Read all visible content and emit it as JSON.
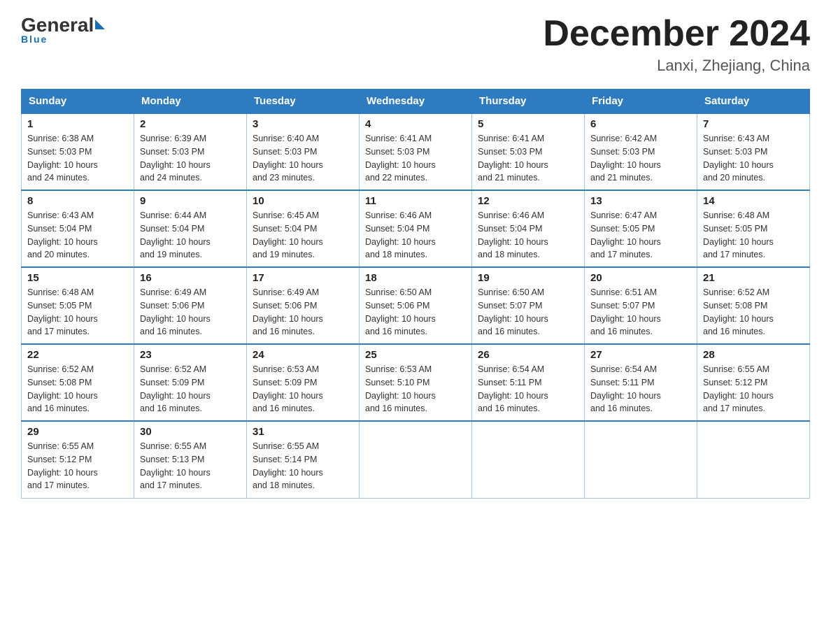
{
  "logo": {
    "general": "General",
    "blue": "Blue",
    "underline": "Blue"
  },
  "title": "December 2024",
  "location": "Lanxi, Zhejiang, China",
  "headers": [
    "Sunday",
    "Monday",
    "Tuesday",
    "Wednesday",
    "Thursday",
    "Friday",
    "Saturday"
  ],
  "weeks": [
    [
      {
        "day": "1",
        "sunrise": "6:38 AM",
        "sunset": "5:03 PM",
        "daylight": "10 hours and 24 minutes."
      },
      {
        "day": "2",
        "sunrise": "6:39 AM",
        "sunset": "5:03 PM",
        "daylight": "10 hours and 24 minutes."
      },
      {
        "day": "3",
        "sunrise": "6:40 AM",
        "sunset": "5:03 PM",
        "daylight": "10 hours and 23 minutes."
      },
      {
        "day": "4",
        "sunrise": "6:41 AM",
        "sunset": "5:03 PM",
        "daylight": "10 hours and 22 minutes."
      },
      {
        "day": "5",
        "sunrise": "6:41 AM",
        "sunset": "5:03 PM",
        "daylight": "10 hours and 21 minutes."
      },
      {
        "day": "6",
        "sunrise": "6:42 AM",
        "sunset": "5:03 PM",
        "daylight": "10 hours and 21 minutes."
      },
      {
        "day": "7",
        "sunrise": "6:43 AM",
        "sunset": "5:03 PM",
        "daylight": "10 hours and 20 minutes."
      }
    ],
    [
      {
        "day": "8",
        "sunrise": "6:43 AM",
        "sunset": "5:04 PM",
        "daylight": "10 hours and 20 minutes."
      },
      {
        "day": "9",
        "sunrise": "6:44 AM",
        "sunset": "5:04 PM",
        "daylight": "10 hours and 19 minutes."
      },
      {
        "day": "10",
        "sunrise": "6:45 AM",
        "sunset": "5:04 PM",
        "daylight": "10 hours and 19 minutes."
      },
      {
        "day": "11",
        "sunrise": "6:46 AM",
        "sunset": "5:04 PM",
        "daylight": "10 hours and 18 minutes."
      },
      {
        "day": "12",
        "sunrise": "6:46 AM",
        "sunset": "5:04 PM",
        "daylight": "10 hours and 18 minutes."
      },
      {
        "day": "13",
        "sunrise": "6:47 AM",
        "sunset": "5:05 PM",
        "daylight": "10 hours and 17 minutes."
      },
      {
        "day": "14",
        "sunrise": "6:48 AM",
        "sunset": "5:05 PM",
        "daylight": "10 hours and 17 minutes."
      }
    ],
    [
      {
        "day": "15",
        "sunrise": "6:48 AM",
        "sunset": "5:05 PM",
        "daylight": "10 hours and 17 minutes."
      },
      {
        "day": "16",
        "sunrise": "6:49 AM",
        "sunset": "5:06 PM",
        "daylight": "10 hours and 16 minutes."
      },
      {
        "day": "17",
        "sunrise": "6:49 AM",
        "sunset": "5:06 PM",
        "daylight": "10 hours and 16 minutes."
      },
      {
        "day": "18",
        "sunrise": "6:50 AM",
        "sunset": "5:06 PM",
        "daylight": "10 hours and 16 minutes."
      },
      {
        "day": "19",
        "sunrise": "6:50 AM",
        "sunset": "5:07 PM",
        "daylight": "10 hours and 16 minutes."
      },
      {
        "day": "20",
        "sunrise": "6:51 AM",
        "sunset": "5:07 PM",
        "daylight": "10 hours and 16 minutes."
      },
      {
        "day": "21",
        "sunrise": "6:52 AM",
        "sunset": "5:08 PM",
        "daylight": "10 hours and 16 minutes."
      }
    ],
    [
      {
        "day": "22",
        "sunrise": "6:52 AM",
        "sunset": "5:08 PM",
        "daylight": "10 hours and 16 minutes."
      },
      {
        "day": "23",
        "sunrise": "6:52 AM",
        "sunset": "5:09 PM",
        "daylight": "10 hours and 16 minutes."
      },
      {
        "day": "24",
        "sunrise": "6:53 AM",
        "sunset": "5:09 PM",
        "daylight": "10 hours and 16 minutes."
      },
      {
        "day": "25",
        "sunrise": "6:53 AM",
        "sunset": "5:10 PM",
        "daylight": "10 hours and 16 minutes."
      },
      {
        "day": "26",
        "sunrise": "6:54 AM",
        "sunset": "5:11 PM",
        "daylight": "10 hours and 16 minutes."
      },
      {
        "day": "27",
        "sunrise": "6:54 AM",
        "sunset": "5:11 PM",
        "daylight": "10 hours and 16 minutes."
      },
      {
        "day": "28",
        "sunrise": "6:55 AM",
        "sunset": "5:12 PM",
        "daylight": "10 hours and 17 minutes."
      }
    ],
    [
      {
        "day": "29",
        "sunrise": "6:55 AM",
        "sunset": "5:12 PM",
        "daylight": "10 hours and 17 minutes."
      },
      {
        "day": "30",
        "sunrise": "6:55 AM",
        "sunset": "5:13 PM",
        "daylight": "10 hours and 17 minutes."
      },
      {
        "day": "31",
        "sunrise": "6:55 AM",
        "sunset": "5:14 PM",
        "daylight": "10 hours and 18 minutes."
      },
      null,
      null,
      null,
      null
    ]
  ],
  "sunrise_label": "Sunrise:",
  "sunset_label": "Sunset:",
  "daylight_label": "Daylight:"
}
